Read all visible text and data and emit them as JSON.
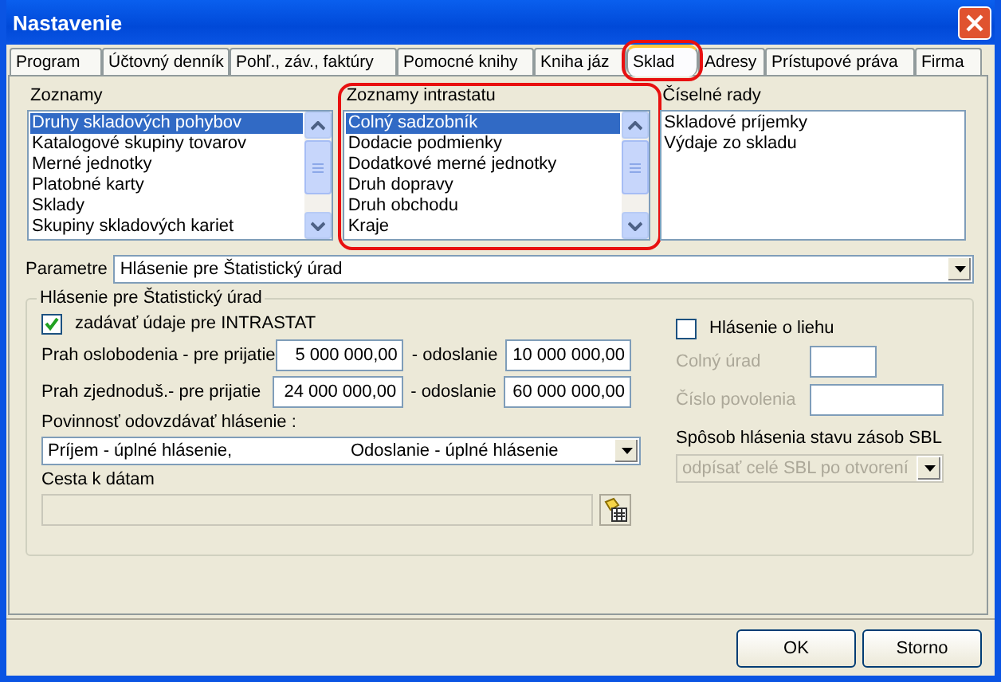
{
  "window": {
    "title": "Nastavenie"
  },
  "tabs": [
    {
      "label": "Program",
      "selected": false,
      "highlighted": false
    },
    {
      "label": "Účtovný denník",
      "selected": false,
      "highlighted": false
    },
    {
      "label": "Pohľ., záv., faktúry",
      "selected": false,
      "highlighted": false
    },
    {
      "label": "Pomocné knihy",
      "selected": false,
      "highlighted": false
    },
    {
      "label": "Kniha jáz",
      "selected": false,
      "highlighted": false
    },
    {
      "label": "Sklad",
      "selected": true,
      "highlighted": true
    },
    {
      "label": "Adresy",
      "selected": false,
      "highlighted": false
    },
    {
      "label": "Prístupové práva",
      "selected": false,
      "highlighted": false
    },
    {
      "label": "Firma",
      "selected": false,
      "highlighted": false
    }
  ],
  "lists": [
    {
      "label": "Zoznamy",
      "highlighted": false,
      "scrollbar": true,
      "items": [
        {
          "text": "Druhy skladových pohybov",
          "selected": true
        },
        {
          "text": "Katalogové skupiny tovarov",
          "selected": false
        },
        {
          "text": "Merné jednotky",
          "selected": false
        },
        {
          "text": "Platobné karty",
          "selected": false
        },
        {
          "text": "Sklady",
          "selected": false
        },
        {
          "text": "Skupiny skladových kariet",
          "selected": false
        }
      ]
    },
    {
      "label": "Zoznamy intrastatu",
      "highlighted": true,
      "scrollbar": true,
      "items": [
        {
          "text": "Colný sadzobník",
          "selected": true
        },
        {
          "text": "Dodacie podmienky",
          "selected": false
        },
        {
          "text": "Dodatkové merné jednotky",
          "selected": false
        },
        {
          "text": "Druh dopravy",
          "selected": false
        },
        {
          "text": "Druh obchodu",
          "selected": false
        },
        {
          "text": "Kraje",
          "selected": false
        }
      ]
    },
    {
      "label": "Číselné rady",
      "highlighted": false,
      "scrollbar": false,
      "items": [
        {
          "text": "Skladové príjemky",
          "selected": false
        },
        {
          "text": "Výdaje zo skladu",
          "selected": false
        }
      ]
    }
  ],
  "parametre": {
    "label": "Parametre",
    "value": "Hlásenie pre Štatistický úrad"
  },
  "group": {
    "title": "Hlásenie pre Štatistický úrad",
    "intrastat": {
      "label": "zadávať údaje pre INTRASTAT",
      "checked": true
    },
    "thresholds": [
      {
        "label": "Prah oslobodenia - pre prijatie",
        "receive": "5 000 000,00",
        "send_label": "- odoslanie",
        "send": "10 000 000,00"
      },
      {
        "label": "Prah zjednoduš.- pre prijatie",
        "receive": "24 000 000,00",
        "send_label": "- odoslanie",
        "send": "60 000 000,00"
      }
    ],
    "obligation": {
      "label": "Povinnosť odovzdávať hlásenie :",
      "value_1": "Príjem - úplné hlásenie,",
      "value_2": "Odoslanie - úplné hlásenie"
    },
    "path": {
      "label": "Cesta k dátam",
      "disabled": true
    },
    "alcohol": {
      "label": "Hlásenie o liehu",
      "checked": false
    },
    "fields": [
      {
        "label": "Colný úrad",
        "disabled": true
      },
      {
        "label": "Číslo povolenia",
        "disabled": true
      }
    ],
    "sbl": {
      "label": "Spôsob hlásenia stavu zásob SBL",
      "value": "odpísať celé SBL po otvorení",
      "disabled": true
    }
  },
  "buttons": [
    {
      "label": "OK"
    },
    {
      "label": "Storno"
    }
  ]
}
